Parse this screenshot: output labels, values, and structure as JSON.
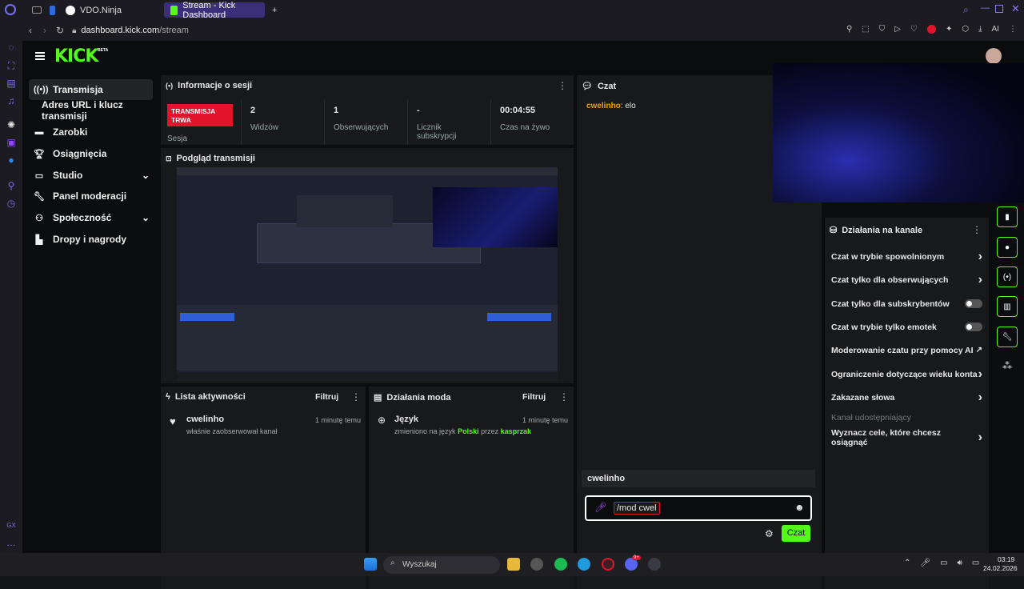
{
  "browser": {
    "tabs": [
      {
        "label": ""
      },
      {
        "label": ""
      },
      {
        "label": "VDO.Ninja"
      },
      {
        "label": "Stream - Kick Dashboard"
      }
    ],
    "new_tab": "+",
    "url_host": "dashboard.kick.com",
    "url_path": "/stream",
    "ai_label": "AI"
  },
  "logo": {
    "text": "KICK",
    "badge": "BETA"
  },
  "sidebar": {
    "items": [
      {
        "label": "Transmisja"
      },
      {
        "label": "Adres URL i klucz transmisji"
      },
      {
        "label": "Zarobki"
      },
      {
        "label": "Osiągnięcia"
      },
      {
        "label": "Studio"
      },
      {
        "label": "Panel moderacji"
      },
      {
        "label": "Społeczność"
      },
      {
        "label": "Dropy i nagrody"
      }
    ]
  },
  "session": {
    "title": "Informacje o sesji",
    "live_badge": "TRANSMISJA TRWA",
    "session_label": "Sesja",
    "stats": [
      {
        "value": "2",
        "label": "Widzów"
      },
      {
        "value": "1",
        "label": "Obserwujących"
      },
      {
        "value": "-",
        "label": "Licznik subskrypcji"
      },
      {
        "value": "00:04:55",
        "label": "Czas na żywo"
      }
    ]
  },
  "preview": {
    "title": "Podgląd transmisji"
  },
  "activity": {
    "title": "Lista aktywności",
    "filter": "Filtruj",
    "items": [
      {
        "user": "cwelinho",
        "text": "właśnie zaobserwował kanał",
        "time": "1 minutę temu"
      }
    ]
  },
  "modactions": {
    "title": "Działania moda",
    "filter": "Filtruj",
    "item": {
      "title": "Język",
      "text_pre": "zmieniono na język",
      "lang": "Polski",
      "text_mid": "przez",
      "by": "kasprzak",
      "time": "1 minutę temu"
    }
  },
  "chat": {
    "title": "Czat",
    "messages": [
      {
        "user": "cwelinho",
        "text": ": elo"
      }
    ],
    "suggestion": "cwelinho",
    "input_value": "/mod cwel",
    "send": "Czat"
  },
  "channel_actions": {
    "title": "Działania na kanale",
    "rows": [
      {
        "label": "Czat w trybie spowolnionym",
        "control": "chevron"
      },
      {
        "label": "Czat tylko dla obserwujących",
        "control": "chevron"
      },
      {
        "label": "Czat tylko dla subskrybentów",
        "control": "toggle"
      },
      {
        "label": "Czat w trybie tylko emotek",
        "control": "toggle"
      },
      {
        "label": "Moderowanie czatu przy pomocy AI",
        "control": "external"
      },
      {
        "label": "Ograniczenie dotyczące wieku konta",
        "control": "chevron"
      },
      {
        "label": "Zakazane słowa",
        "control": "chevron"
      },
      {
        "label": "Kanał udostępniający",
        "control": "none"
      },
      {
        "label": "Wyznacz cele, które chcesz osiągnąć",
        "control": "chevron"
      }
    ]
  },
  "taskbar": {
    "search": "Wyszukaj",
    "time": "03:19",
    "date": "24.02.2026",
    "badge": "9+"
  },
  "opera_side": {
    "bottom": "GX"
  },
  "colors": {
    "kick_green": "#53fc18",
    "live_red": "#e3132b",
    "orange_user": "#f0a000"
  }
}
